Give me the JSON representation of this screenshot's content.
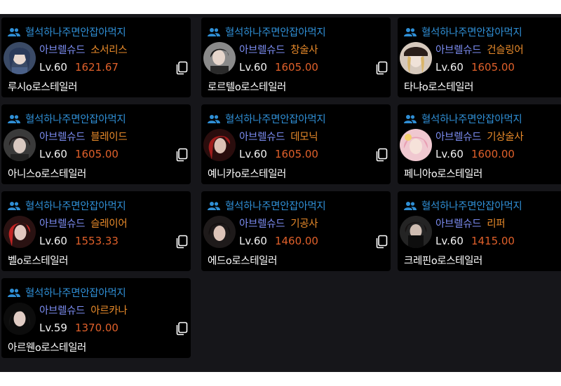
{
  "cards": [
    {
      "guild": "혈석하나주면안잡아먹지",
      "server": "아브렐슈드",
      "class": "소서리스",
      "level": "Lv.60",
      "item_level": "1621.67",
      "name": "루시o로스테일러"
    },
    {
      "guild": "혈석하나주면안잡아먹지",
      "server": "아브렐슈드",
      "class": "창술사",
      "level": "Lv.60",
      "item_level": "1605.00",
      "name": "로르텔o로스테일러"
    },
    {
      "guild": "혈석하나주면안잡아먹지",
      "server": "아브렐슈드",
      "class": "건슬링어",
      "level": "Lv.60",
      "item_level": "1605.00",
      "name": "타냐o로스테일러"
    },
    {
      "guild": "혈석하나주면안잡아먹지",
      "server": "아브렐슈드",
      "class": "블레이드",
      "level": "Lv.60",
      "item_level": "1605.00",
      "name": "아니스o로스테일러"
    },
    {
      "guild": "혈석하나주면안잡아먹지",
      "server": "아브렐슈드",
      "class": "데모닉",
      "level": "Lv.60",
      "item_level": "1605.00",
      "name": "예니카o로스테일러"
    },
    {
      "guild": "혈석하나주면안잡아먹지",
      "server": "아브렐슈드",
      "class": "기상술사",
      "level": "Lv.60",
      "item_level": "1600.00",
      "name": "페니아o로스테일러"
    },
    {
      "guild": "혈석하나주면안잡아먹지",
      "server": "아브렐슈드",
      "class": "슬레이어",
      "level": "Lv.60",
      "item_level": "1553.33",
      "name": "벨o로스테일러"
    },
    {
      "guild": "혈석하나주면안잡아먹지",
      "server": "아브렐슈드",
      "class": "기공사",
      "level": "Lv.60",
      "item_level": "1460.00",
      "name": "에드o로스테일러"
    },
    {
      "guild": "혈석하나주면안잡아먹지",
      "server": "아브렐슈드",
      "class": "리퍼",
      "level": "Lv.60",
      "item_level": "1415.00",
      "name": "크레핀o로스테일러"
    },
    {
      "guild": "혈석하나주면안잡아먹지",
      "server": "아브렐슈드",
      "class": "아르카나",
      "level": "Lv.59",
      "item_level": "1370.00",
      "name": "아르웬o로스테일러"
    }
  ],
  "icons": {
    "guild": "people-icon",
    "copy": "copy-icon"
  },
  "colors": {
    "guild": "#2f8fd6",
    "server": "#7b8cf0",
    "class": "#e88a2a",
    "item_level": "#e0602a",
    "card_bg": "#000000",
    "panel_bg": "#16161a"
  }
}
